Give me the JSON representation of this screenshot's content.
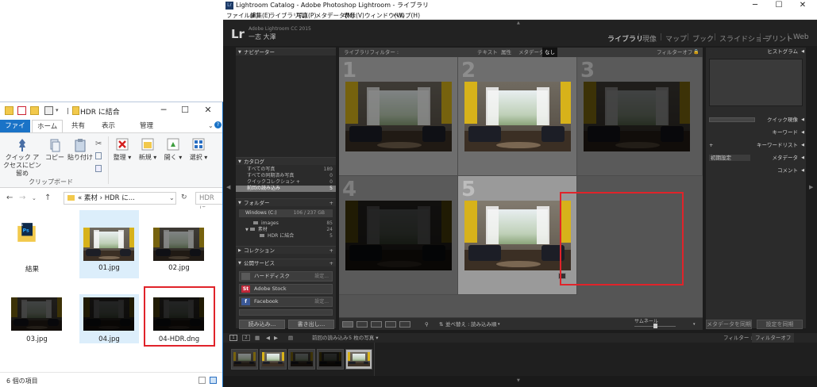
{
  "explorer": {
    "title": "HDR に結合",
    "tabs": {
      "file": "ファイル",
      "home": "ホーム",
      "share": "共有",
      "view": "表示",
      "manage": "管理"
    },
    "ribbon": {
      "quick_access": "クイック アクセスにピン留め",
      "copy": "コピー",
      "paste": "貼り付け",
      "clipboard_group": "クリップボード",
      "organize": "整理",
      "new": "新規",
      "open": "開く",
      "select": "選択"
    },
    "address": {
      "path": "«  素材  ›  HDR に...",
      "search_placeholder": "HDR に..."
    },
    "files": [
      {
        "name": "結果"
      },
      {
        "name": "01.jpg"
      },
      {
        "name": "02.jpg"
      },
      {
        "name": "03.jpg"
      },
      {
        "name": "04.jpg"
      },
      {
        "name": "04-HDR.dng"
      }
    ],
    "status": "6 個の項目",
    "window_controls": {
      "minimize": "─",
      "maximize": "☐",
      "close": "✕"
    }
  },
  "lightroom": {
    "title": "Lightroom Catalog - Adobe Photoshop Lightroom - ライブラリ",
    "menu": [
      "ファイル(F)",
      "編集(E)",
      "ライブラリ(L)",
      "写真(P)",
      "メタデータ(M)",
      "表示(V)",
      "ウィンドウ(W)",
      "ヘルプ(H)"
    ],
    "identity": {
      "logo": "Lr",
      "version": "Adobe Lightroom CC 2015",
      "user": "一志 大澤"
    },
    "modules": [
      "ライブラリ",
      "現像",
      "マップ",
      "ブック",
      "スライドショー",
      "プリント",
      "Web"
    ],
    "active_module": "ライブラリ",
    "left_panel": {
      "navigator": "ナビゲーター",
      "catalog": {
        "header": "カタログ",
        "rows": [
          {
            "label": "すべての写真",
            "count": "189"
          },
          {
            "label": "すべての同期済み写真",
            "count": "0"
          },
          {
            "label": "クイックコレクション +",
            "count": "0"
          },
          {
            "label": "前回の読み込み",
            "count": "5"
          }
        ]
      },
      "folders": {
        "header": "フォルダー",
        "volume": "Windows (C:)",
        "volume_info": "106 / 237 GB",
        "rows": [
          {
            "label": "images",
            "count": "85"
          },
          {
            "label": "素材",
            "count": "24"
          },
          {
            "label": "HDR に結合",
            "count": "5"
          }
        ]
      },
      "collections": "コレクション",
      "publish": {
        "header": "公開サービス",
        "services": [
          {
            "label": "ハードディスク",
            "badge": "",
            "action": "設定..."
          },
          {
            "label": "Adobe Stock",
            "badge": "St",
            "action": ""
          },
          {
            "label": "Facebook",
            "badge": "f",
            "action": "設定..."
          }
        ]
      },
      "import_button": "読み込み...",
      "export_button": "書き出し..."
    },
    "filter_bar": {
      "label": "ライブラリフィルター :",
      "text": "テキスト",
      "attribute": "属性",
      "metadata": "メタデータ",
      "none": "なし",
      "filter_off": "フィルターオフ"
    },
    "grid": {
      "cells": [
        "1",
        "2",
        "3",
        "4",
        "5"
      ],
      "selected": "5"
    },
    "toolbar": {
      "sort_label": "並べ替え :",
      "sort_value": "読み込み順",
      "thumbs_label": "サムネール"
    },
    "right_panel": {
      "histogram": "ヒストグラム",
      "quick_develop": "クイック現像",
      "keywording": "キーワード",
      "keyword_list": "キーワードリスト",
      "metadata_preset": "初期設定",
      "metadata": "メタデータ",
      "comments": "コメント",
      "sync_metadata": "メタデータを同期",
      "sync_settings": "設定を同期"
    },
    "filmstrip": {
      "pages": [
        "1",
        "2"
      ],
      "source": "前回の読み込み",
      "info": "5 枚の写真 ▾",
      "filter_label": "フィルター :",
      "filter_value": "フィルターオフ"
    },
    "colors": {
      "panel": "#2b2b2b",
      "grid": "#555555",
      "red_highlight": "#e0232a",
      "curtain": "#d7b21a"
    }
  }
}
